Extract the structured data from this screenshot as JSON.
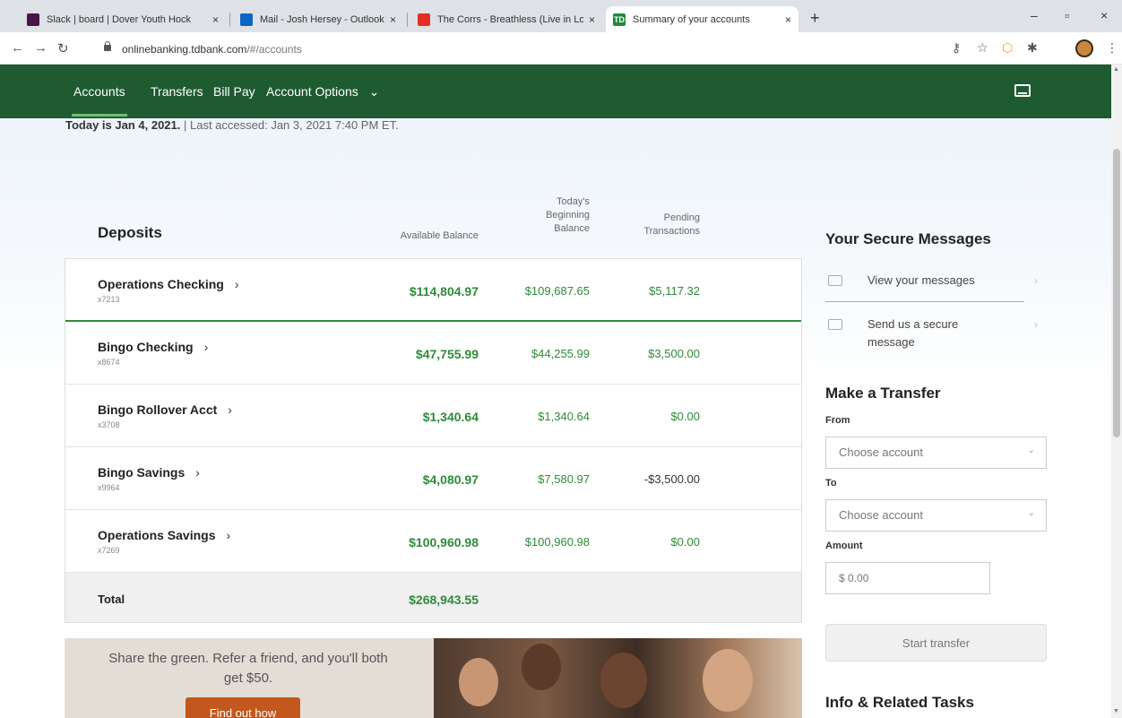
{
  "browser": {
    "tabs": [
      {
        "title": "Slack | board | Dover Youth Hock",
        "color": "#4a154b"
      },
      {
        "title": "Mail - Josh Hersey - Outlook",
        "color": "#0a66c2"
      },
      {
        "title": "The Corrs - Breathless (Live in Lo",
        "color": "#e52d27"
      },
      {
        "title": "Summary of your accounts",
        "color": "#1f8a3b"
      }
    ],
    "tab_close": "×",
    "new_tab": "+",
    "url_domain": "onlinebanking.tdbank.com",
    "url_path": "/#/accounts",
    "window_controls": {
      "minimize": "–",
      "maximize": "▫",
      "close": "×"
    }
  },
  "nav": {
    "items": [
      "Accounts",
      "Transfers",
      "Bill Pay",
      "Account Options"
    ],
    "dropdown_caret": "⌄",
    "active": "Accounts"
  },
  "header": {
    "today": "Today is Jan 4, 2021.",
    "last_accessed": " | Last accessed: Jan 3, 2021 7:40 PM ET."
  },
  "deposits": {
    "title": "Deposits",
    "columns": {
      "available": "Available Balance",
      "beginning_line1": "Today's",
      "beginning_line2": "Beginning",
      "beginning_line3": "Balance",
      "pending_line1": "Pending",
      "pending_line2": "Transactions"
    },
    "accounts": [
      {
        "name": "Operations Checking",
        "number": "x7213",
        "available": "$114,804.97",
        "beginning": "$109,687.65",
        "pending": "$5,117.32"
      },
      {
        "name": "Bingo Checking",
        "number": "x8674",
        "available": "$47,755.99",
        "beginning": "$44,255.99",
        "pending": "$3,500.00"
      },
      {
        "name": "Bingo Rollover Acct",
        "number": "x3708",
        "available": "$1,340.64",
        "beginning": "$1,340.64",
        "pending": "$0.00"
      },
      {
        "name": "Bingo Savings",
        "number": "x9964",
        "available": "$4,080.97",
        "beginning": "$7,580.97",
        "pending": "-$3,500.00"
      },
      {
        "name": "Operations Savings",
        "number": "x7269",
        "available": "$100,960.98",
        "beginning": "$100,960.98",
        "pending": "$0.00"
      }
    ],
    "total_label": "Total",
    "total_value": "$268,943.55",
    "chevron": "›"
  },
  "promo": {
    "line1": "Share the green. Refer a friend, and you'll both",
    "line2": "get $50.",
    "button": "Find out how"
  },
  "sidebar": {
    "messages_title": "Your Secure Messages",
    "view_messages": "View your messages",
    "send_line1": "Send us a secure",
    "send_line2": "message",
    "chevron": "›",
    "transfer_title": "Make a Transfer",
    "from_label": "From",
    "to_label": "To",
    "amount_label": "Amount",
    "from_placeholder": "Choose account",
    "to_placeholder": "Choose account",
    "amount_value": "$ 0.00",
    "select_caret": "⌄",
    "start_button": "Start transfer",
    "info_title": "Info & Related Tasks"
  }
}
